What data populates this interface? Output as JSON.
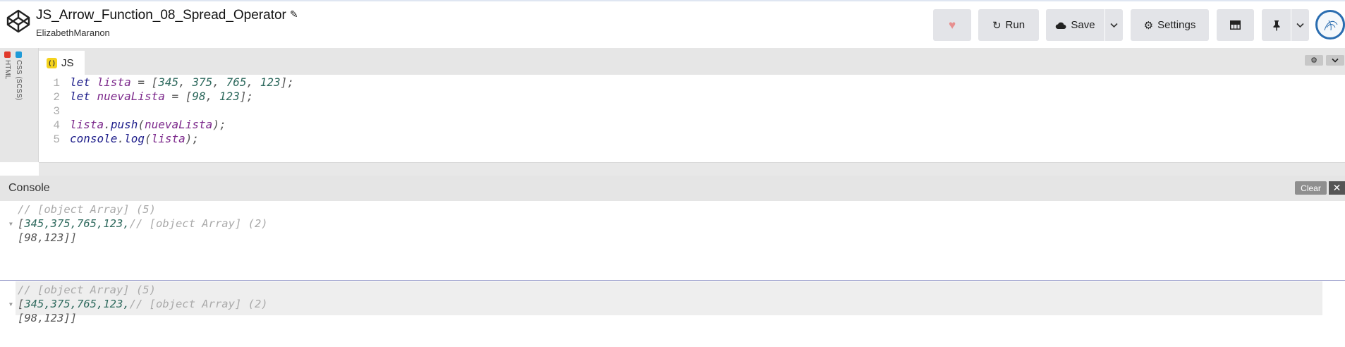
{
  "header": {
    "title": "JS_Arrow_Function_08_Spread_Operator",
    "author": "ElizabethMaranon",
    "buttons": {
      "run": "Run",
      "save": "Save",
      "settings": "Settings"
    }
  },
  "side_tabs": [
    {
      "label": "HTML",
      "color": "#e0392b"
    },
    {
      "label": "CSS (SCSS)",
      "color": "#1f9bd8"
    }
  ],
  "editor": {
    "tab_label": "JS",
    "tab_badge": "( )",
    "lines": [
      {
        "n": "1",
        "tokens": [
          [
            "kw",
            "let "
          ],
          [
            "var",
            "lista"
          ],
          [
            "pun",
            " = ["
          ],
          [
            "num",
            "345"
          ],
          [
            "pun",
            ", "
          ],
          [
            "num",
            "375"
          ],
          [
            "pun",
            ", "
          ],
          [
            "num",
            "765"
          ],
          [
            "pun",
            ", "
          ],
          [
            "num",
            "123"
          ],
          [
            "pun",
            "];"
          ]
        ]
      },
      {
        "n": "2",
        "tokens": [
          [
            "kw",
            "let "
          ],
          [
            "var",
            "nuevaLista"
          ],
          [
            "pun",
            " = ["
          ],
          [
            "num",
            "98"
          ],
          [
            "pun",
            ", "
          ],
          [
            "num",
            "123"
          ],
          [
            "pun",
            "];"
          ]
        ]
      },
      {
        "n": "3",
        "tokens": []
      },
      {
        "n": "4",
        "tokens": [
          [
            "var",
            "lista"
          ],
          [
            "pun",
            "."
          ],
          [
            "fn",
            "push"
          ],
          [
            "pun",
            "("
          ],
          [
            "var",
            "nuevaLista"
          ],
          [
            "pun",
            ");"
          ]
        ]
      },
      {
        "n": "5",
        "tokens": [
          [
            "fn",
            "console"
          ],
          [
            "pun",
            "."
          ],
          [
            "fn",
            "log"
          ],
          [
            "pun",
            "("
          ],
          [
            "var",
            "lista"
          ],
          [
            "pun",
            ");"
          ]
        ]
      }
    ]
  },
  "console": {
    "title": "Console",
    "clear_label": "Clear",
    "entries": [
      {
        "comment_outer": "// [object Array] (5)",
        "row2_prefix": "[",
        "row2_values": "345,375,765,123,",
        "comment_inner": "// [object Array] (2)",
        "row3": "[98,123]]"
      },
      {
        "comment_outer": "// [object Array] (5)",
        "row2_prefix": "[",
        "row2_values": "345,375,765,123,",
        "comment_inner": "// [object Array] (2)",
        "row3": "[98,123]]"
      }
    ]
  },
  "colors": {
    "accent_js": "#f4d21c",
    "heart": "#e78f8f",
    "avatar_ring": "#2a6db0"
  }
}
